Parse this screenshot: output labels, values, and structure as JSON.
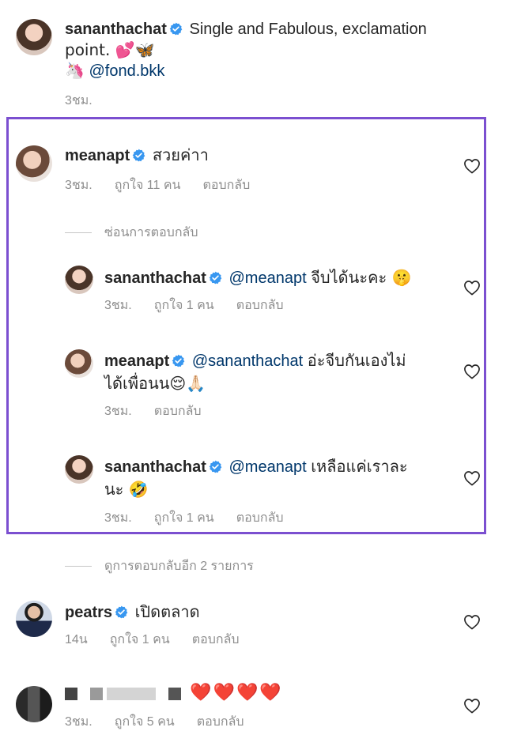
{
  "colors": {
    "accent_frame": "#7b4fd0",
    "verified": "#3897f0",
    "mention": "#00376b",
    "meta": "#8e8e8e"
  },
  "caption": {
    "username": "sananthachat",
    "text": "Single and Fabulous, exclamation",
    "text2": "point. 💕🦋",
    "tag_emoji": "🦄",
    "tag": "@fond.bkk",
    "time": "3ชม."
  },
  "comment1": {
    "username": "meanapt",
    "text": "สวยค่าา",
    "time": "3ชม.",
    "likes": "ถูกใจ 11 คน",
    "reply": "ตอบกลับ"
  },
  "hide_replies": "ซ่อนการตอบกลับ",
  "reply1": {
    "username": "sananthachat",
    "mention": "@meanapt",
    "text": "จีบได้นะคะ 🤫",
    "time": "3ชม.",
    "likes": "ถูกใจ 1 คน",
    "reply": "ตอบกลับ"
  },
  "reply2": {
    "username": "meanapt",
    "mention": "@sananthachat",
    "text": "อ่ะจีบกันเองไม่",
    "text2": "ได้เพื่อนน😌🙏🏻",
    "time": "3ชม.",
    "reply": "ตอบกลับ"
  },
  "reply3": {
    "username": "sananthachat",
    "mention": "@meanapt",
    "text": "เหลือแค่เราละ",
    "text2": "นะ 🤣",
    "time": "3ชม.",
    "likes": "ถูกใจ 1 คน",
    "reply": "ตอบกลับ"
  },
  "view_more": "ดูการตอบกลับอีก 2 รายการ",
  "comment2": {
    "username": "peatrs",
    "text": "เปิดตลาด",
    "time": "14น",
    "likes": "ถูกใจ 1 คน",
    "reply": "ตอบกลับ"
  },
  "comment3": {
    "text": "❤️❤️❤️❤️",
    "time": "3ชม.",
    "likes": "ถูกใจ 5 คน",
    "reply": "ตอบกลับ"
  }
}
